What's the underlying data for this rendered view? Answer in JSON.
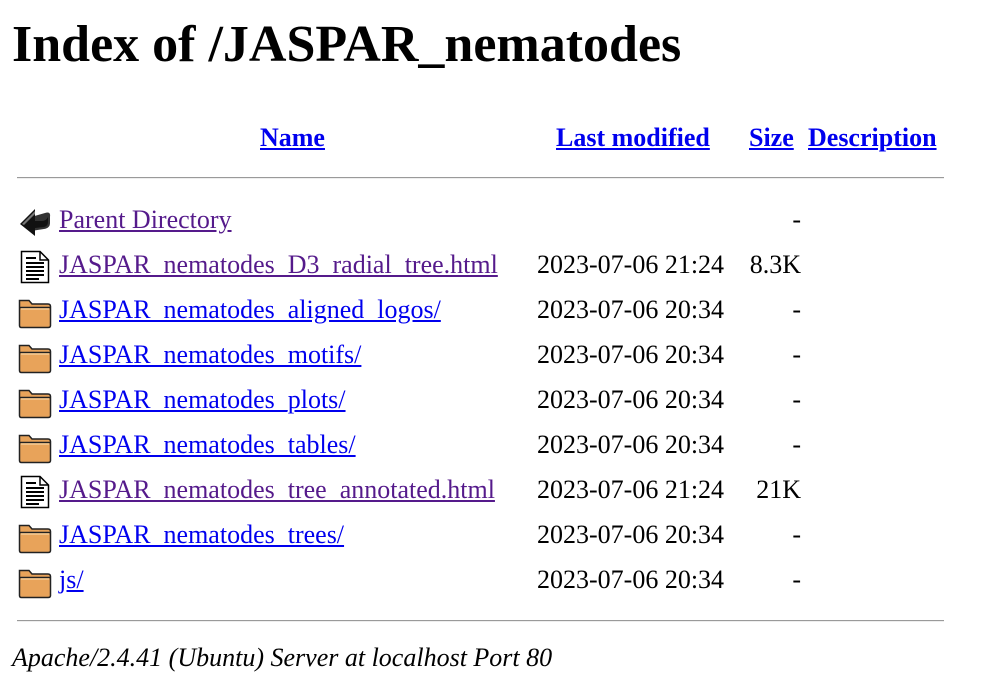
{
  "page": {
    "title": "Index of /JASPAR_nematodes"
  },
  "columns": {
    "name": "Name",
    "last_modified": "Last modified",
    "size": "Size",
    "description": "Description"
  },
  "rows": [
    {
      "icon": "back-icon",
      "name": "Parent Directory",
      "date": "",
      "size": "-",
      "visited": true
    },
    {
      "icon": "text-file-icon",
      "name": "JASPAR_nematodes_D3_radial_tree.html",
      "date": "2023-07-06 21:24",
      "size": "8.3K",
      "visited": true
    },
    {
      "icon": "folder-icon",
      "name": "JASPAR_nematodes_aligned_logos/",
      "date": "2023-07-06 20:34",
      "size": "-",
      "visited": false
    },
    {
      "icon": "folder-icon",
      "name": "JASPAR_nematodes_motifs/",
      "date": "2023-07-06 20:34",
      "size": "-",
      "visited": false
    },
    {
      "icon": "folder-icon",
      "name": "JASPAR_nematodes_plots/",
      "date": "2023-07-06 20:34",
      "size": "-",
      "visited": false
    },
    {
      "icon": "folder-icon",
      "name": "JASPAR_nematodes_tables/",
      "date": "2023-07-06 20:34",
      "size": "-",
      "visited": false
    },
    {
      "icon": "text-file-icon",
      "name": "JASPAR_nematodes_tree_annotated.html",
      "date": "2023-07-06 21:24",
      "size": "21K",
      "visited": true
    },
    {
      "icon": "folder-icon",
      "name": "JASPAR_nematodes_trees/",
      "date": "2023-07-06 20:34",
      "size": "-",
      "visited": false
    },
    {
      "icon": "folder-icon",
      "name": "js/",
      "date": "2023-07-06 20:34",
      "size": "-",
      "visited": false
    }
  ],
  "footer": {
    "server": "Apache/2.4.41 (Ubuntu) Server at localhost Port 80"
  },
  "colors": {
    "link": "#0000ee",
    "visited_link": "#551a8b",
    "folder": "#e8a35a"
  }
}
